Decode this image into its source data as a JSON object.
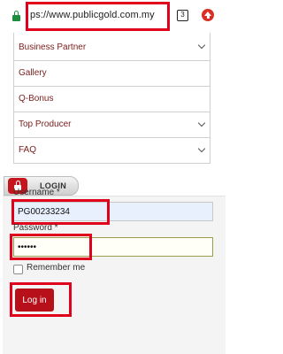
{
  "browser": {
    "url": "ps://www.publicgold.com.my",
    "tab_count": "3"
  },
  "menu": {
    "items": [
      {
        "label": "Business Partner",
        "has_dropdown": true
      },
      {
        "label": "Gallery",
        "has_dropdown": false
      },
      {
        "label": "Q-Bonus",
        "has_dropdown": false
      },
      {
        "label": "Top Producer",
        "has_dropdown": true
      },
      {
        "label": "FAQ",
        "has_dropdown": true
      }
    ]
  },
  "login": {
    "tab_label": "LOGIN",
    "username_label": "Username *",
    "username_value": "PG00233234",
    "password_label": "Password *",
    "password_value": "••••••",
    "remember_label": "Remember me",
    "remember_checked": false,
    "submit_label": "Log in"
  },
  "colors": {
    "highlight": "#e0001b",
    "brand": "#b8101a",
    "menu_text": "#7a1d1d"
  }
}
